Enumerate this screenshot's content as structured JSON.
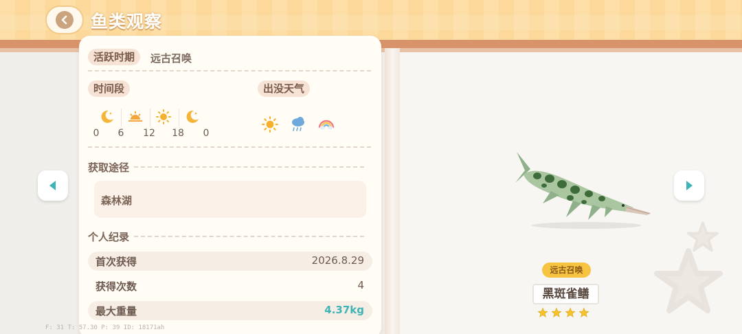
{
  "header": {
    "title": "鱼类观察"
  },
  "info": {
    "active_period_label": "活跃时期",
    "active_period_value": "远古召唤",
    "time_label": "时间段",
    "weather_label": "出没天气",
    "time_ticks": [
      "0",
      "6",
      "12",
      "18",
      "0"
    ],
    "time_icons": [
      "moon-icon",
      "sunrise-icon",
      "sun-icon",
      "moon-icon"
    ],
    "weather_icons": [
      "sun-icon",
      "rain-cloud-icon",
      "rainbow-icon"
    ],
    "source_label": "获取途径",
    "source_value": "森林湖",
    "record_label": "个人纪录",
    "records": [
      {
        "label": "首次获得",
        "value": "2026.8.29"
      },
      {
        "label": "获得次数",
        "value": "4"
      },
      {
        "label": "最大重量",
        "value": "4.37kg"
      }
    ]
  },
  "fish": {
    "rarity_tag": "远古召唤",
    "name": "黑斑雀鳝",
    "stars": 4
  },
  "debug": "F: 31   T: 57.30   P: 39   ID: 18171ah",
  "colors": {
    "banner": "#fcd99a",
    "accent_teal": "#3fb4b6",
    "star_gold": "#f5c22c",
    "rarity_gold": "#f7c442"
  }
}
